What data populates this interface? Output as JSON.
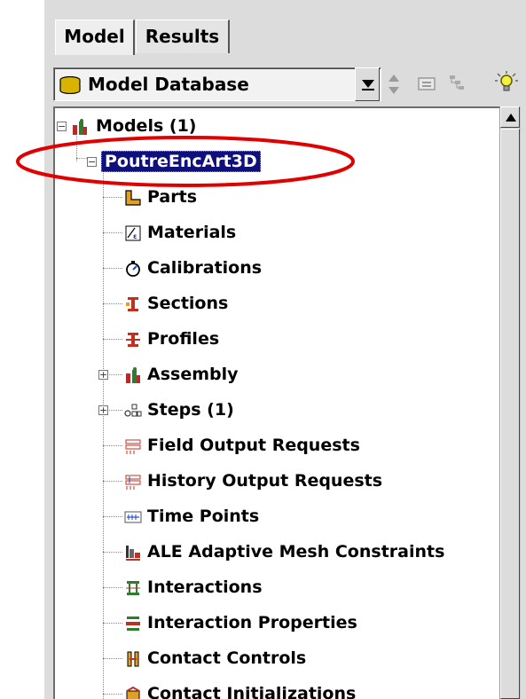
{
  "tabs": [
    {
      "label": "Model",
      "active": true
    },
    {
      "label": "Results",
      "active": false
    }
  ],
  "combo": {
    "selected": "Model Database"
  },
  "tree": {
    "root": {
      "label": "Models (1)"
    },
    "model": {
      "label": "PoutreEncArt3D",
      "selected": true
    },
    "items": [
      {
        "label": "Parts",
        "icon": "parts-icon",
        "expandable": false
      },
      {
        "label": "Materials",
        "icon": "materials-icon",
        "expandable": false
      },
      {
        "label": "Calibrations",
        "icon": "calibrations-icon",
        "expandable": false
      },
      {
        "label": "Sections",
        "icon": "sections-icon",
        "expandable": false
      },
      {
        "label": "Profiles",
        "icon": "profiles-icon",
        "expandable": false
      },
      {
        "label": "Assembly",
        "icon": "assembly-icon",
        "expandable": true
      },
      {
        "label": "Steps (1)",
        "icon": "steps-icon",
        "expandable": true
      },
      {
        "label": "Field Output Requests",
        "icon": "field-output-icon",
        "expandable": false
      },
      {
        "label": "History Output Requests",
        "icon": "history-output-icon",
        "expandable": false
      },
      {
        "label": "Time Points",
        "icon": "time-points-icon",
        "expandable": false
      },
      {
        "label": "ALE Adaptive Mesh Constraints",
        "icon": "ale-mesh-icon",
        "expandable": false
      },
      {
        "label": "Interactions",
        "icon": "interactions-icon",
        "expandable": false
      },
      {
        "label": "Interaction Properties",
        "icon": "interaction-properties-icon",
        "expandable": false
      },
      {
        "label": "Contact Controls",
        "icon": "contact-controls-icon",
        "expandable": false
      },
      {
        "label": "Contact Initializations",
        "icon": "contact-initializations-icon",
        "expandable": false
      }
    ]
  },
  "colors": {
    "selection_bg": "#10107a",
    "annotation_ellipse": "#e00000",
    "panel_bg": "#dcdcdc"
  }
}
